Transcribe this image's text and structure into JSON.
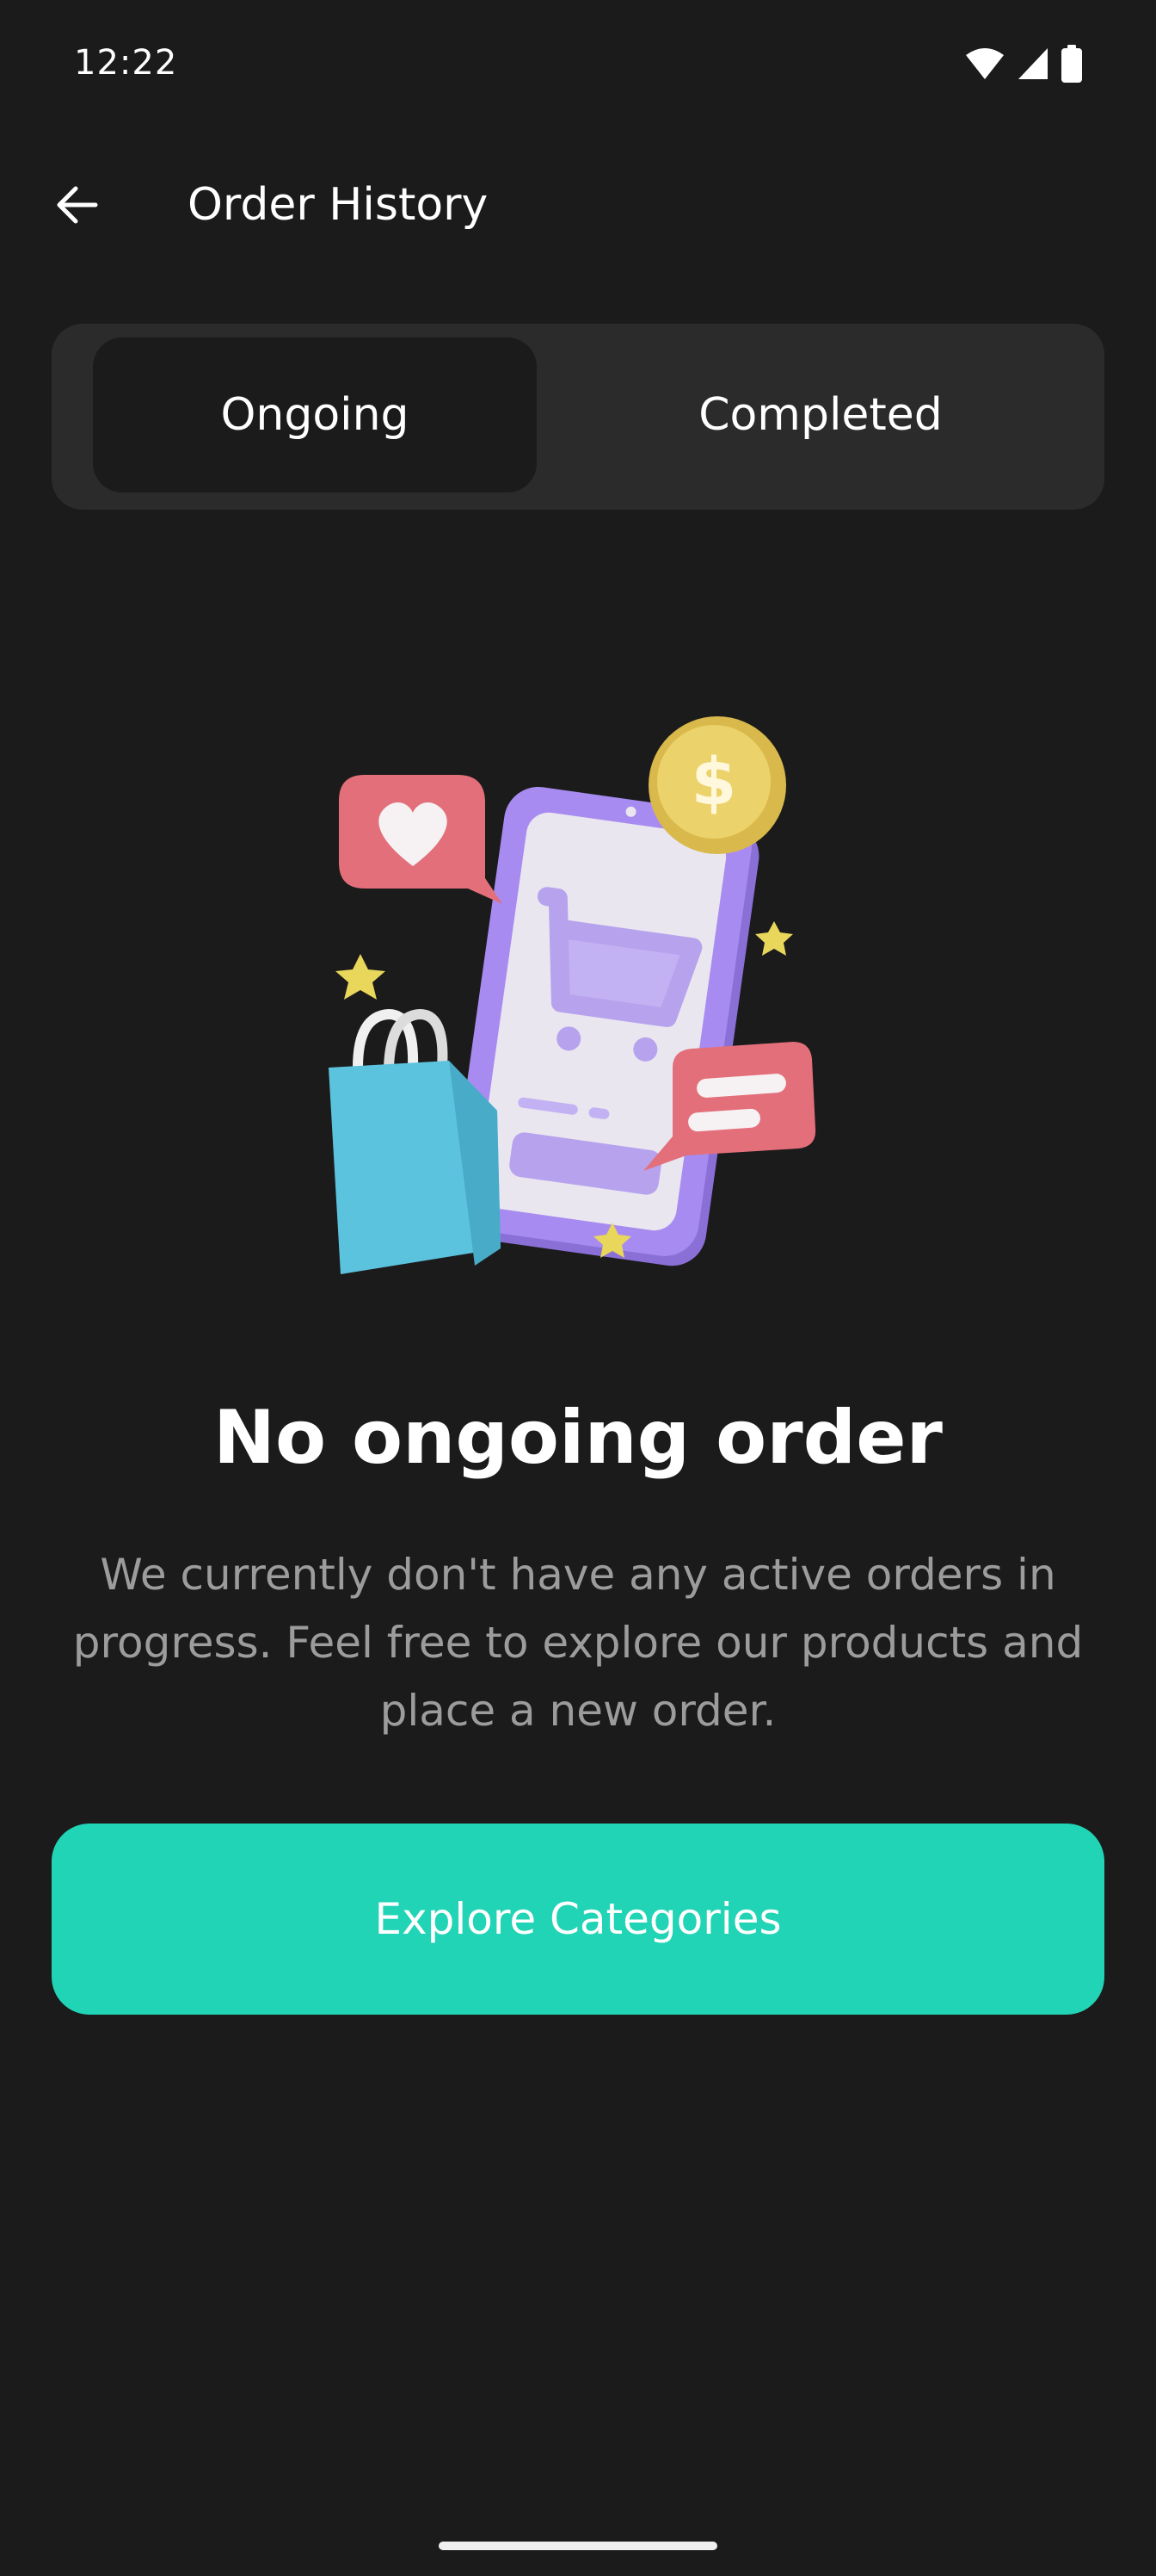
{
  "status_bar": {
    "time": "12:22",
    "icons": [
      "wifi-icon",
      "signal-icon",
      "battery-icon"
    ]
  },
  "app_bar": {
    "back_icon": "arrow-left-icon",
    "title": "Order History"
  },
  "tabs": [
    {
      "label": "Ongoing",
      "selected": true
    },
    {
      "label": "Completed",
      "selected": false
    }
  ],
  "illustration": {
    "icon": "shopping-phone-illustration"
  },
  "empty_state": {
    "title": "No ongoing order",
    "description": "We currently don't have any active orders in progress. Feel free to explore our products and place a new order."
  },
  "primary_action": {
    "label": "Explore Categories"
  },
  "colors": {
    "background": "#1b1b1b",
    "tab_container": "#2b2b2b",
    "accent": "#21d4b5",
    "muted_text": "#9c9c9c"
  }
}
